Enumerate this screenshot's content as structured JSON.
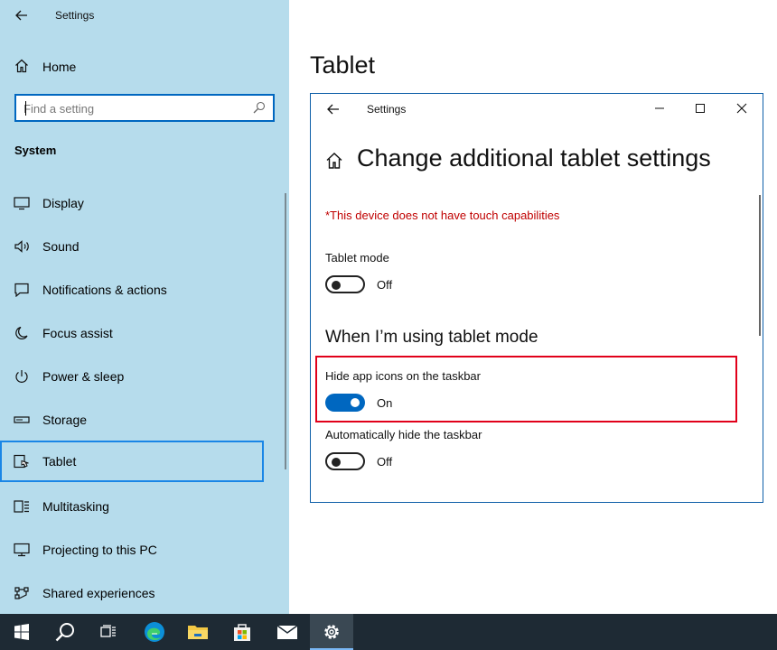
{
  "sidebar": {
    "app_title": "Settings",
    "home_label": "Home",
    "search_placeholder": "Find a setting",
    "section_label": "System",
    "items": [
      {
        "label": "Display",
        "icon": "display-icon"
      },
      {
        "label": "Sound",
        "icon": "sound-icon"
      },
      {
        "label": "Notifications & actions",
        "icon": "notifications-icon"
      },
      {
        "label": "Focus assist",
        "icon": "moon-icon"
      },
      {
        "label": "Power & sleep",
        "icon": "power-icon"
      },
      {
        "label": "Storage",
        "icon": "storage-icon"
      },
      {
        "label": "Tablet",
        "icon": "tablet-icon",
        "selected": true
      },
      {
        "label": "Multitasking",
        "icon": "multitasking-icon"
      },
      {
        "label": "Projecting to this PC",
        "icon": "projecting-icon"
      },
      {
        "label": "Shared experiences",
        "icon": "shared-experiences-icon"
      }
    ]
  },
  "main": {
    "page_title": "Tablet"
  },
  "dialog": {
    "title": "Settings",
    "heading": "Change additional tablet settings",
    "warning": "*This device does not have touch capabilities",
    "tablet_mode": {
      "label": "Tablet mode",
      "state": "Off"
    },
    "section_heading": "When I’m using tablet mode",
    "hide_icons": {
      "label": "Hide app icons on the taskbar",
      "state": "On"
    },
    "auto_hide": {
      "label": "Automatically hide the taskbar",
      "state": "Off"
    }
  },
  "taskbar": {
    "icons": [
      "windows-start-icon",
      "search-icon",
      "task-view-icon",
      "edge-icon",
      "file-explorer-icon",
      "store-icon",
      "mail-icon",
      "settings-gear-icon"
    ],
    "active": "settings-gear-icon"
  },
  "colors": {
    "sidebar_bg": "#b6dcec",
    "accent": "#0067c0",
    "warning": "#c00000",
    "highlight": "#e1001a",
    "taskbar": "#1e2a34"
  }
}
